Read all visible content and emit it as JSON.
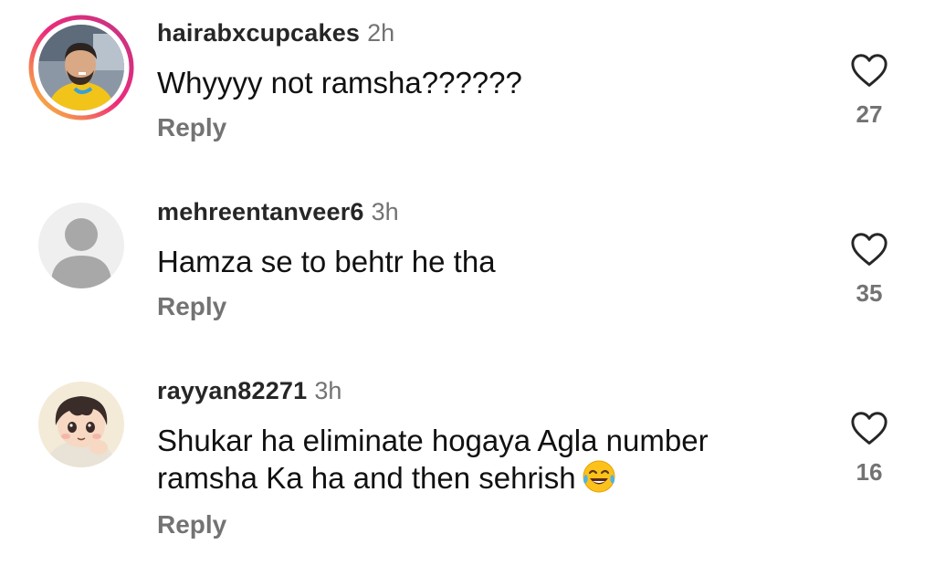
{
  "comments": [
    {
      "username": "hairabxcupcakes",
      "time": "2h",
      "text": "Whyyyy not ramsha??????",
      "reply": "Reply",
      "likes": "27",
      "avatar": "photo-man-yellow-shirt",
      "has_story_ring": true
    },
    {
      "username": "mehreentanveer6",
      "time": "3h",
      "text": "Hamza se to behtr he tha",
      "reply": "Reply",
      "likes": "35",
      "avatar": "default-user-silhouette",
      "has_story_ring": false
    },
    {
      "username": "rayyan82271",
      "time": "3h",
      "text": "Shukar ha eliminate hogaya Agla number ramsha Ka ha and then sehrish",
      "reply": "Reply",
      "likes": "16",
      "avatar": "cartoon-boy",
      "has_story_ring": false,
      "emoji": "face-with-tears-of-joy"
    }
  ],
  "colors": {
    "username": "#262626",
    "secondary": "#737373",
    "text": "#111111",
    "ring_start": "#f9ce34",
    "ring_mid": "#ee2a7b",
    "ring_end": "#6228d7"
  }
}
